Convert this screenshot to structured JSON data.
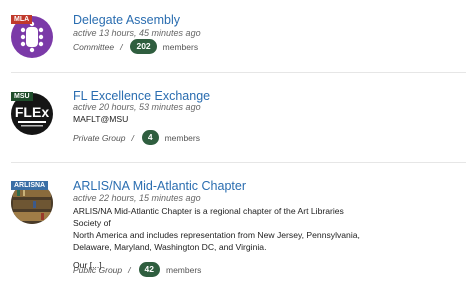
{
  "groups": [
    {
      "avatar_tag": "MLA",
      "title": "Delegate Assembly",
      "active": "active 13 hours, 45 minutes ago",
      "description": [],
      "type": "Committee",
      "separator": "/",
      "member_count": "202",
      "members_label": "members"
    },
    {
      "avatar_tag": "MSU",
      "avatar_text": "FLEx",
      "title": "FL Excellence Exchange",
      "active": "active 20 hours, 53 minutes ago",
      "description": [
        "MAFLT@MSU"
      ],
      "type": "Private Group",
      "separator": "/",
      "member_count": "4",
      "members_label": "members"
    },
    {
      "avatar_tag": "ARLISNA",
      "title": "ARLIS/NA Mid-Atlantic Chapter",
      "active": "active 22 hours, 15 minutes ago",
      "description": [
        "ARLIS/NA Mid-Atlantic Chapter is a regional chapter of the Art Libraries Society of",
        "North America and includes representation from New Jersey, Pennsylvania,",
        "Delaware, Maryland, Washington DC, and Virginia.",
        "",
        "Our [...]"
      ],
      "type": "Public Group",
      "separator": "/",
      "member_count": "42",
      "members_label": "members"
    }
  ],
  "colors": {
    "link": "#2a6db0",
    "badge": "#2f5e3f",
    "mla_tag": "#c0392b",
    "msu_tag": "#1f4d2b",
    "arlis_tag": "#3a6ea5",
    "mla_avatar": "#7b3aa8"
  }
}
